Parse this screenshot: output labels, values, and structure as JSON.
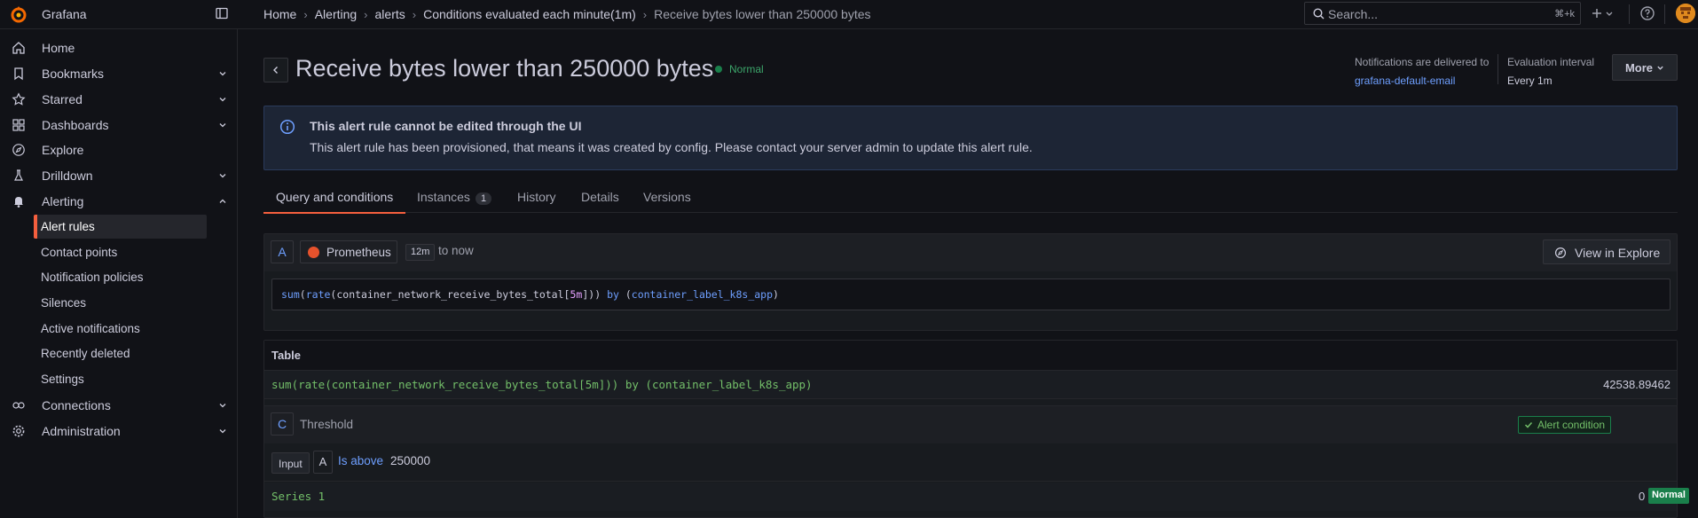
{
  "app": {
    "brand": "Grafana"
  },
  "breadcrumb": [
    "Home",
    "Alerting",
    "alerts",
    "Conditions evaluated each minute(1m)",
    "Receive bytes lower than 250000 bytes"
  ],
  "search": {
    "placeholder": "Search...",
    "shortcut": "⌘+k"
  },
  "sidebar": {
    "items": [
      {
        "label": "Home",
        "icon": "home-icon"
      },
      {
        "label": "Bookmarks",
        "icon": "bookmark-icon"
      },
      {
        "label": "Starred",
        "icon": "star-icon"
      },
      {
        "label": "Dashboards",
        "icon": "dashboards-icon"
      },
      {
        "label": "Explore",
        "icon": "compass-icon"
      },
      {
        "label": "Drilldown",
        "icon": "drilldown-icon"
      },
      {
        "label": "Alerting",
        "icon": "bell-icon"
      }
    ],
    "alerting_sub": [
      "Alert rules",
      "Contact points",
      "Notification policies",
      "Silences",
      "Active notifications",
      "Recently deleted",
      "Settings"
    ],
    "bottom_items": [
      {
        "label": "Connections",
        "icon": "plug-icon"
      },
      {
        "label": "Administration",
        "icon": "gear-icon"
      }
    ]
  },
  "header": {
    "title": "Receive bytes lower than 250000 bytes",
    "state": "Normal",
    "notif_label": "Notifications are delivered to",
    "notif_value": "grafana-default-email",
    "eval_label": "Evaluation interval",
    "eval_value": "Every 1m",
    "more": "More"
  },
  "alert": {
    "title": "This alert rule cannot be edited through the UI",
    "desc": "This alert rule has been provisioned, that means it was created by config. Please contact your server admin to update this alert rule."
  },
  "tabs": [
    {
      "label": "Query and conditions"
    },
    {
      "label": "Instances",
      "count": "1"
    },
    {
      "label": "History"
    },
    {
      "label": "Details"
    },
    {
      "label": "Versions"
    }
  ],
  "query": {
    "ref": "A",
    "datasource": "Prometheus",
    "range": "12m",
    "range_suffix": "to now",
    "explore": "View in Explore"
  },
  "table": {
    "title": "Table",
    "series": "sum(rate(container_network_receive_bytes_total[5m])) by (container_label_k8s_app)",
    "value": "42538.89462"
  },
  "threshold": {
    "ref": "C",
    "label": "Threshold",
    "condition": "Alert condition",
    "input_label": "Input",
    "input_ref": "A",
    "operator": "Is above",
    "value": "250000",
    "series": "Series 1",
    "series_value": "0",
    "series_state": "Normal"
  },
  "colors": {
    "accent": "#f55f3e",
    "link": "#6e9fff",
    "ok": "#1a7f4b"
  }
}
